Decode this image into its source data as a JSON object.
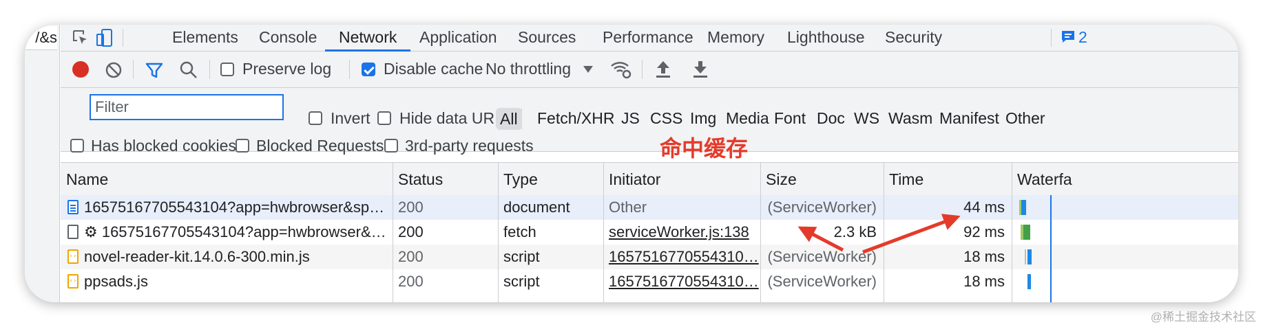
{
  "left_fragment": "/&s",
  "tabs": [
    "Elements",
    "Console",
    "Network",
    "Application",
    "Sources",
    "Performance",
    "Memory",
    "Lighthouse",
    "Security"
  ],
  "active_tab": "Network",
  "issues_badge": "2",
  "toolbar": {
    "preserve_log": "Preserve log",
    "disable_cache": "Disable cache",
    "throttling": "No throttling",
    "preserve_log_checked": false,
    "disable_cache_checked": true
  },
  "filter": {
    "placeholder": "Filter",
    "value": "Filter",
    "invert": "Invert",
    "hide_data_urls": "Hide data URLs",
    "types": [
      "All",
      "Fetch/XHR",
      "JS",
      "CSS",
      "Img",
      "Media",
      "Font",
      "Doc",
      "WS",
      "Wasm",
      "Manifest",
      "Other"
    ],
    "selected_type": "All",
    "has_blocked_cookies": "Has blocked cookies",
    "blocked_requests": "Blocked Requests",
    "third_party": "3rd-party requests"
  },
  "annotation": "命中缓存",
  "columns": [
    "Name",
    "Status",
    "Type",
    "Initiator",
    "Size",
    "Time",
    "Waterfa"
  ],
  "rows": [
    {
      "icon": "document-icon",
      "name": "16575167705543104?app=hwbrowser&spm…",
      "status": "200",
      "type": "document",
      "initiator": "Other",
      "size": "(ServiceWorker)",
      "time": "44 ms"
    },
    {
      "icon": "fetch-icon",
      "name": "⚙ 16575167705543104?app=hwbrowser&sp…",
      "status": "200",
      "type": "fetch",
      "initiator": "serviceWorker.js:138",
      "size": "2.3 kB",
      "time": "92 ms"
    },
    {
      "icon": "script-icon",
      "name": "novel-reader-kit.14.0.6-300.min.js",
      "status": "200",
      "type": "script",
      "initiator": "1657516770554310…",
      "size": "(ServiceWorker)",
      "time": "18 ms"
    },
    {
      "icon": "script-icon",
      "name": "ppsads.js",
      "status": "200",
      "type": "script",
      "initiator": "1657516770554310…",
      "size": "(ServiceWorker)",
      "time": "18 ms"
    }
  ],
  "watermark": "@稀土掘金技术社区",
  "colors": {
    "record": "#d93025",
    "accent": "#1a73e8",
    "annotation": "#e53a2b"
  }
}
